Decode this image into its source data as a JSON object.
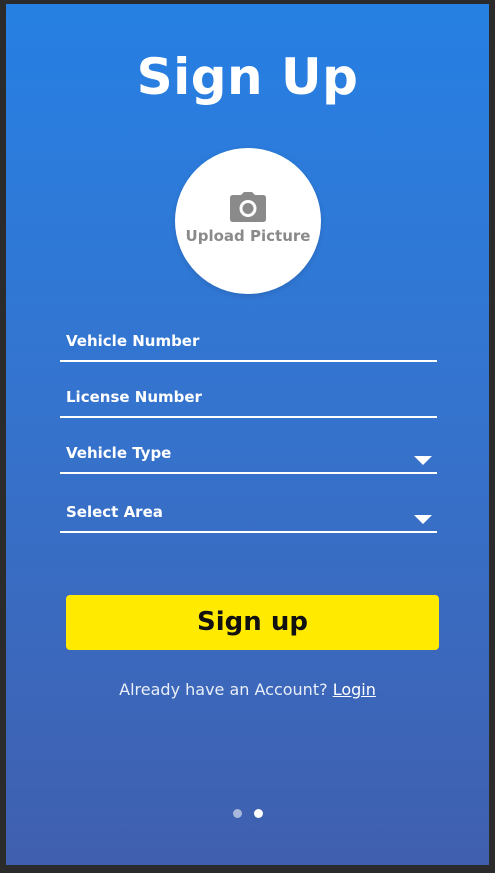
{
  "screen": {
    "title": "Sign Up"
  },
  "avatar": {
    "icon": "camera-icon",
    "label": "Upload Picture"
  },
  "form": {
    "fields": [
      {
        "label": "Vehicle Number",
        "type": "text"
      },
      {
        "label": "License Number",
        "type": "text"
      },
      {
        "label": "Vehicle Type",
        "type": "select",
        "icon": "chevron-down-icon"
      },
      {
        "label": "Select Area",
        "type": "select",
        "icon": "chevron-down-icon"
      }
    ],
    "submit_label": "Sign up"
  },
  "footer": {
    "prompt": "Already have an Account?",
    "login_label": "Login"
  },
  "pager": {
    "total": 2,
    "active_index": 1
  },
  "colors": {
    "gradient_top": "#2680e3",
    "gradient_bottom": "#405fae",
    "button": "#ffea00",
    "text": "#ffffff"
  }
}
